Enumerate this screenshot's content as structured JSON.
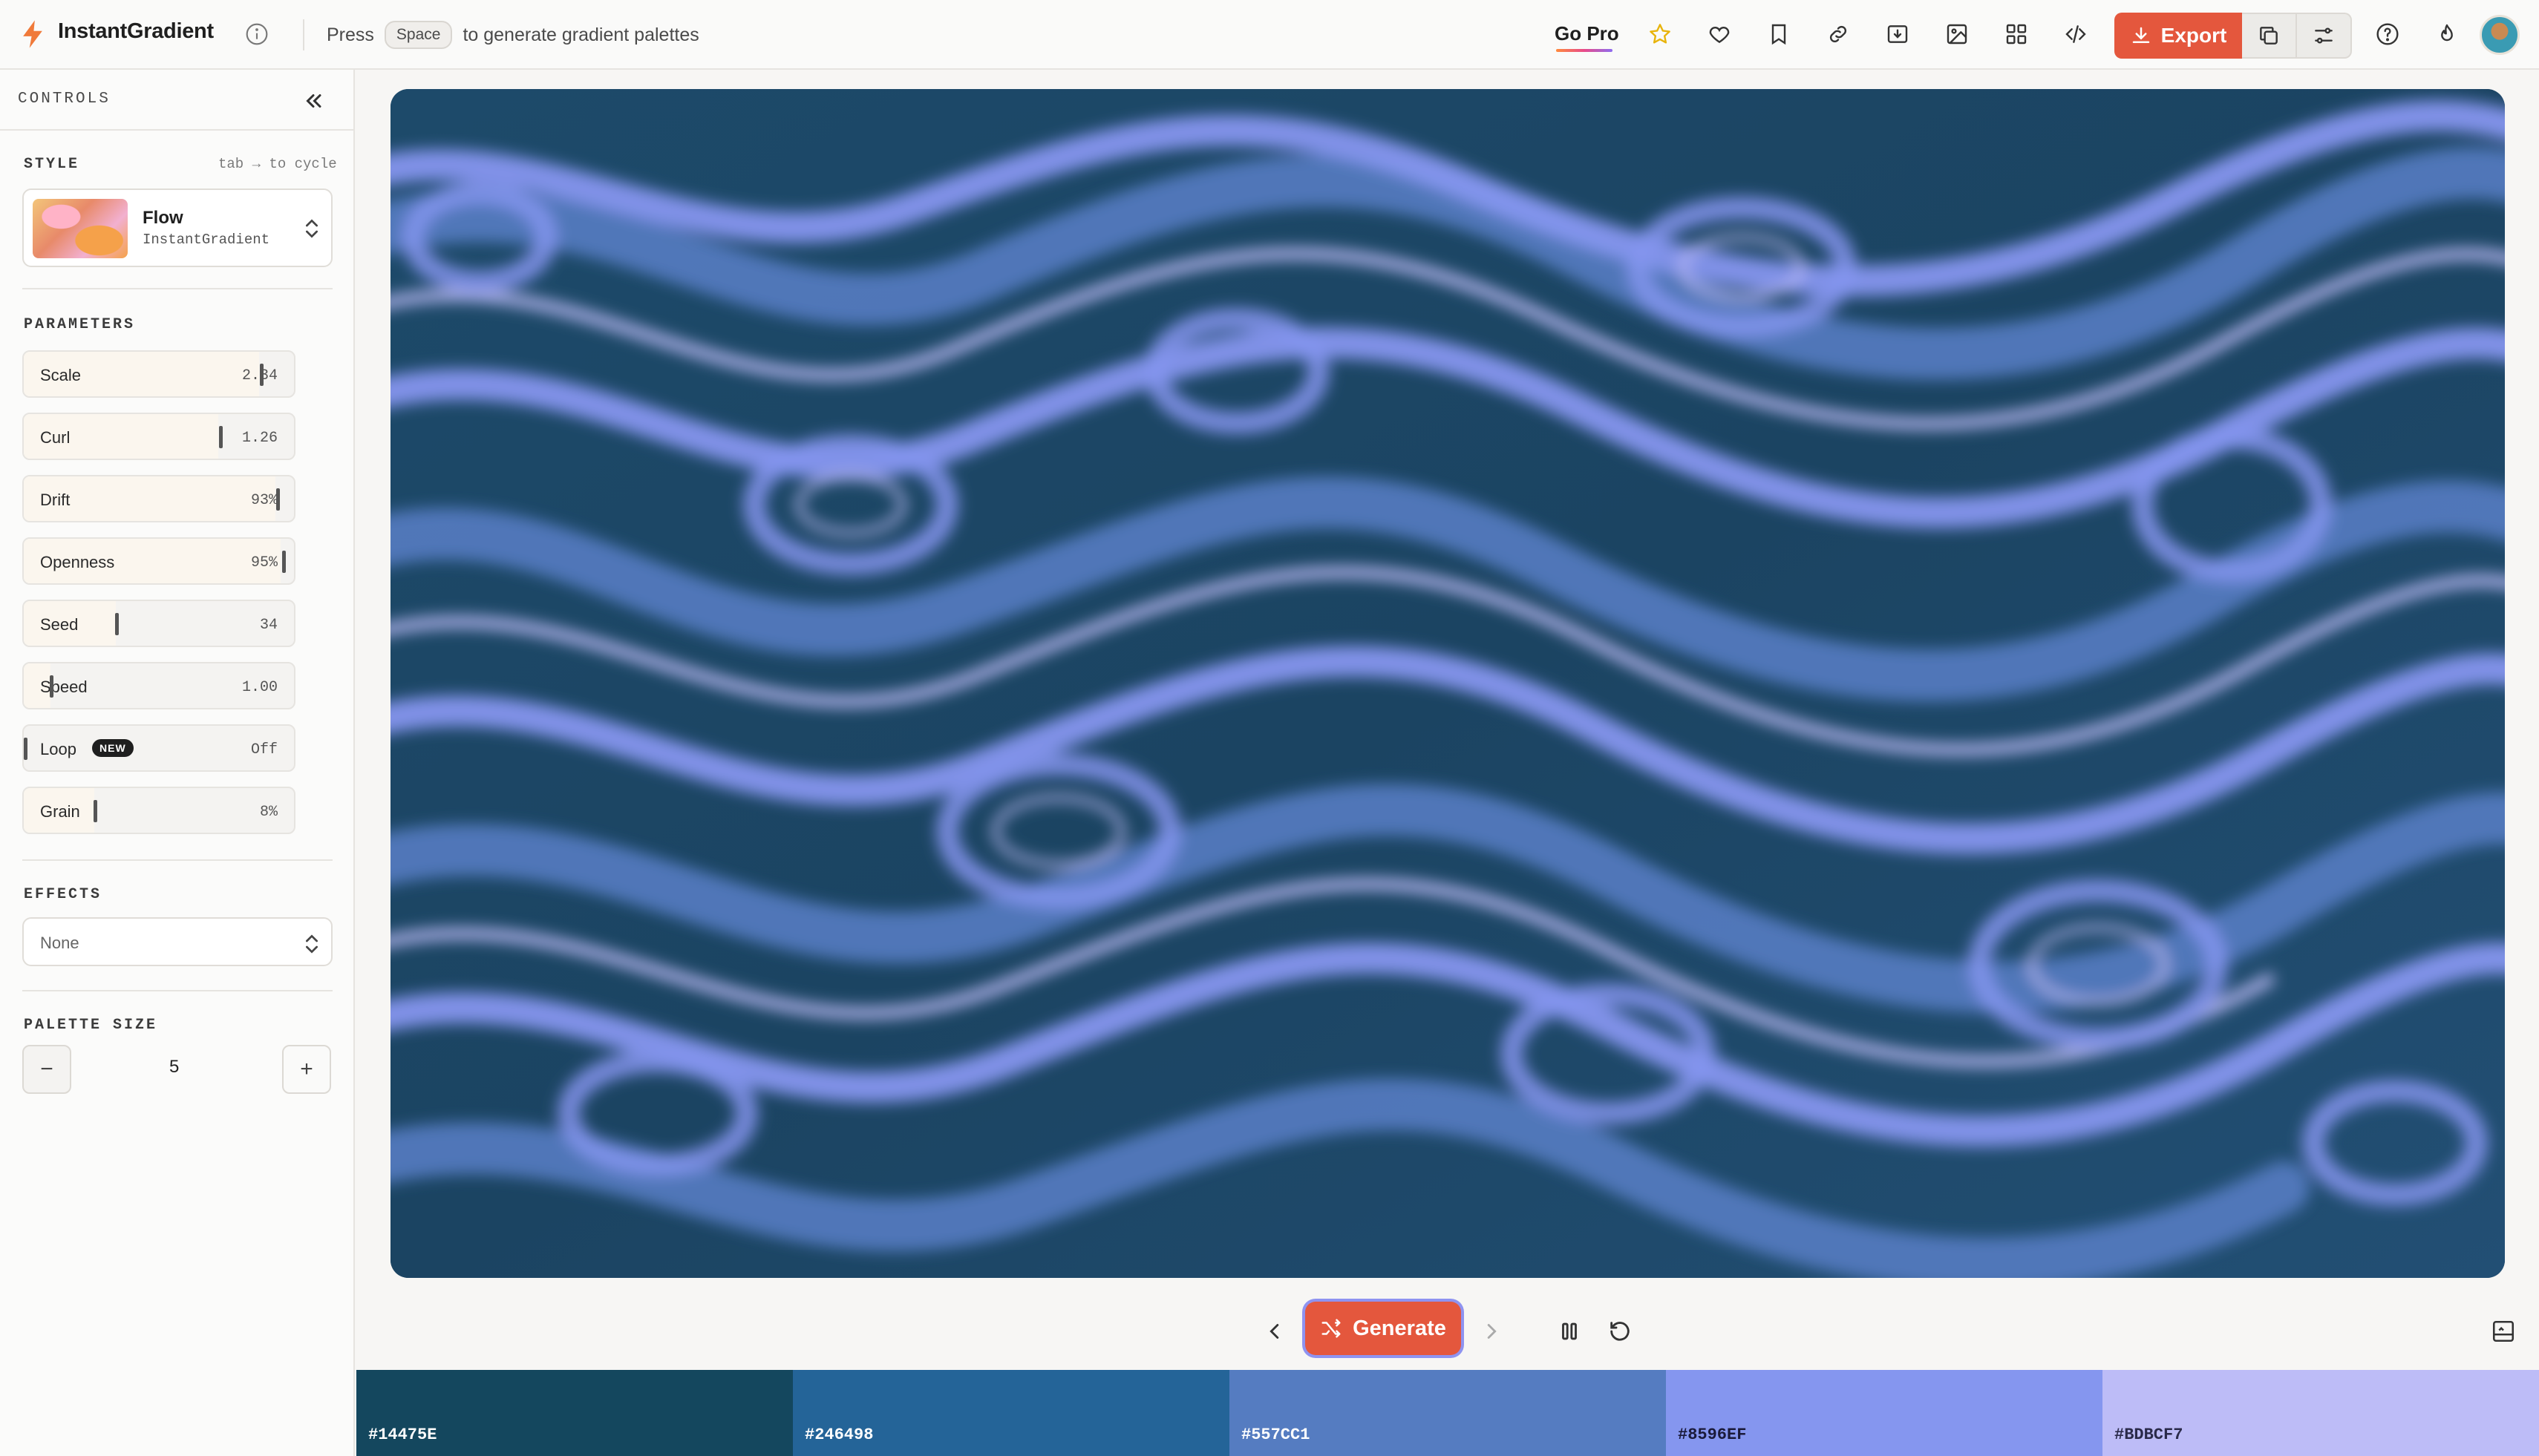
{
  "app": {
    "title": "InstantGradient",
    "hint_before": "Press",
    "hint_key": "Space",
    "hint_after": "to generate gradient palettes"
  },
  "toolbar": {
    "go_pro": "Go Pro",
    "export_label": "Export",
    "icons": [
      "star-icon",
      "heart-icon",
      "bookmark-icon",
      "link-icon",
      "download-icon",
      "image-icon",
      "grid-icon",
      "code-icon",
      "copy-icon",
      "sliders-icon",
      "help-icon",
      "flame-icon"
    ]
  },
  "sidebar": {
    "title": "CONTROLS",
    "style_label": "STYLE",
    "style_hint": "tab → to cycle",
    "style_name": "Flow",
    "style_sub": "InstantGradient",
    "parameters_label": "PARAMETERS",
    "parameters": [
      {
        "label": "Scale",
        "value": "2.34",
        "level": 0.87
      },
      {
        "label": "Curl",
        "value": "1.26",
        "level": 0.72
      },
      {
        "label": "Drift",
        "value": "93%",
        "level": 0.93
      },
      {
        "label": "Openness",
        "value": "95%",
        "level": 0.95
      },
      {
        "label": "Seed",
        "value": "34",
        "level": 0.34
      },
      {
        "label": "Speed",
        "value": "1.00",
        "level": 0.1
      },
      {
        "label": "Loop",
        "value": "Off",
        "level": 0.0,
        "badge": "NEW"
      },
      {
        "label": "Grain",
        "value": "8%",
        "level": 0.26
      }
    ],
    "effects_label": "EFFECTS",
    "effects_value": "None",
    "palette_size_label": "PALETTE SIZE",
    "palette_size": "5",
    "minus": "−",
    "plus": "+"
  },
  "controls": {
    "generate_label": "Generate"
  },
  "palette": [
    {
      "hex": "#14475E",
      "text": "#ffffff"
    },
    {
      "hex": "#246498",
      "text": "#ffffff"
    },
    {
      "hex": "#557CC1",
      "text": "#ffffff"
    },
    {
      "hex": "#8596EF",
      "text": "#1a1a3a"
    },
    {
      "hex": "#BDBCF7",
      "text": "#2a2a4a"
    }
  ],
  "colors": {
    "accent": "#e4573d",
    "focus_ring": "#8f93f0"
  }
}
